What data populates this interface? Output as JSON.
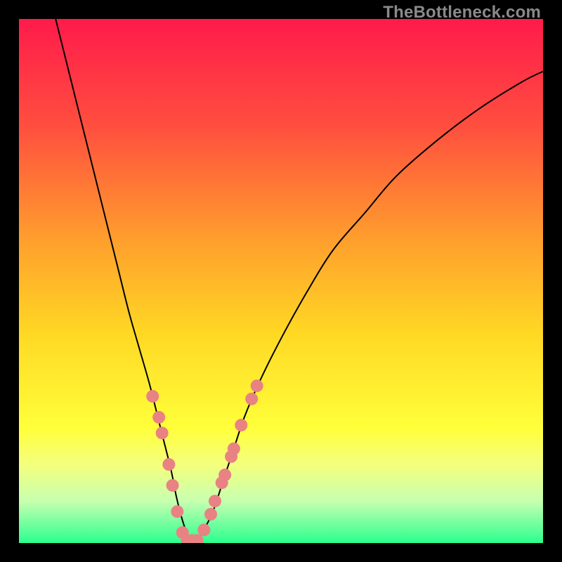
{
  "watermark": "TheBottleneck.com",
  "chart_data": {
    "type": "line",
    "title": "",
    "xlabel": "",
    "ylabel": "",
    "xlim": [
      0,
      100
    ],
    "ylim": [
      0,
      100
    ],
    "grid": false,
    "legend": false,
    "background_gradient": {
      "stops": [
        {
          "offset": 0.0,
          "color": "#ff1b4b"
        },
        {
          "offset": 0.2,
          "color": "#ff4d3f"
        },
        {
          "offset": 0.42,
          "color": "#ff9e2d"
        },
        {
          "offset": 0.6,
          "color": "#ffd824"
        },
        {
          "offset": 0.78,
          "color": "#ffff3a"
        },
        {
          "offset": 0.85,
          "color": "#f4ff7d"
        },
        {
          "offset": 0.92,
          "color": "#c7ffb0"
        },
        {
          "offset": 1.0,
          "color": "#2bff8f"
        }
      ]
    },
    "series": [
      {
        "name": "bottleneck-curve",
        "x": [
          7,
          9,
          11,
          13,
          15,
          17,
          19,
          21,
          23,
          25,
          27,
          29,
          30,
          31,
          32,
          33,
          34,
          35,
          37,
          39,
          41,
          43,
          46,
          50,
          55,
          60,
          66,
          72,
          80,
          88,
          96,
          100
        ],
        "y": [
          100,
          92,
          84,
          76,
          68,
          60,
          52,
          44,
          37,
          30,
          22,
          14,
          9,
          5,
          2,
          0.5,
          0.5,
          2,
          6,
          12,
          18,
          24,
          31,
          39,
          48,
          56,
          63,
          70,
          77,
          83,
          88,
          90
        ]
      }
    ],
    "highlight_points": {
      "name": "dots",
      "color": "#e98282",
      "radius": 9,
      "points": [
        {
          "x": 25.5,
          "y": 28
        },
        {
          "x": 26.7,
          "y": 24
        },
        {
          "x": 27.3,
          "y": 21
        },
        {
          "x": 28.6,
          "y": 15
        },
        {
          "x": 29.3,
          "y": 11
        },
        {
          "x": 30.2,
          "y": 6
        },
        {
          "x": 31.2,
          "y": 2
        },
        {
          "x": 32.1,
          "y": 0.5
        },
        {
          "x": 33.0,
          "y": 0.5
        },
        {
          "x": 34.0,
          "y": 0.5
        },
        {
          "x": 35.3,
          "y": 2.5
        },
        {
          "x": 36.6,
          "y": 5.5
        },
        {
          "x": 37.4,
          "y": 8
        },
        {
          "x": 38.7,
          "y": 11.5
        },
        {
          "x": 39.3,
          "y": 13
        },
        {
          "x": 40.5,
          "y": 16.5
        },
        {
          "x": 41.0,
          "y": 18
        },
        {
          "x": 42.4,
          "y": 22.5
        },
        {
          "x": 44.4,
          "y": 27.5
        },
        {
          "x": 45.4,
          "y": 30
        }
      ]
    }
  }
}
